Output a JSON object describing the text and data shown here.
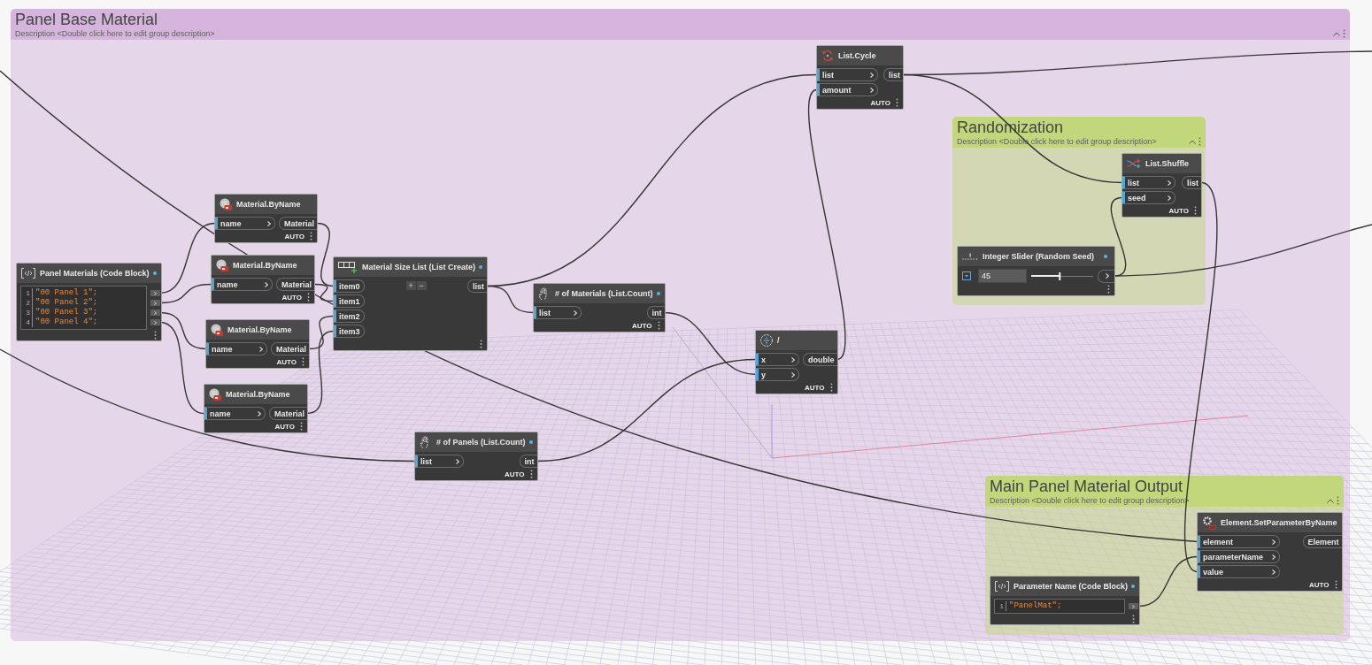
{
  "groups": [
    {
      "title": "Panel Base Material",
      "description": "Description <Double click here to edit group description>",
      "color": "#d5b5dc",
      "nodes": [
        {
          "kind": "cycle",
          "title": "List.Cycle",
          "renamed": false,
          "inputs": [
            "list",
            "amount"
          ],
          "outputs": [
            "list"
          ],
          "lacing": "AUTO"
        },
        {
          "kind": "material",
          "title": "Material.ByName",
          "renamed": false,
          "inputs": [
            "name"
          ],
          "outputs": [
            "Material"
          ],
          "lacing": "AUTO"
        },
        {
          "kind": "codeblock",
          "title": "Panel Materials (Code Block)",
          "renamed": true,
          "lines": [
            {
              "number": "1",
              "code": "\"00 Panel 1\";"
            },
            {
              "number": "2",
              "code": "\"00 Panel 2\";"
            },
            {
              "number": "3",
              "code": "\"00 Panel 3\";"
            },
            {
              "number": "4",
              "code": "\"00 Panel 4\";"
            }
          ]
        },
        {
          "kind": "material",
          "title": "Material.ByName",
          "renamed": false,
          "inputs": [
            "name"
          ],
          "outputs": [
            "Material"
          ],
          "lacing": "AUTO"
        },
        {
          "kind": "material",
          "title": "Material.ByName",
          "renamed": false,
          "inputs": [
            "name"
          ],
          "outputs": [
            "Material"
          ],
          "lacing": "AUTO"
        },
        {
          "kind": "listcreate",
          "title": "Material Size List (List Create)",
          "renamed": true,
          "inputs": [
            "item0",
            "item1",
            "item2",
            "item3"
          ],
          "buttons": [
            "+",
            "−"
          ],
          "outputs": [
            "list"
          ]
        },
        {
          "kind": "count",
          "title": "# of Materials (List.Count)",
          "renamed": true,
          "inputs": [
            "list"
          ],
          "outputs": [
            "int"
          ],
          "lacing": "AUTO"
        },
        {
          "kind": "divide",
          "title": "/",
          "renamed": false,
          "inputs": [
            "x",
            "y"
          ],
          "outputs": [
            "double"
          ],
          "lacing": "AUTO"
        },
        {
          "kind": "material",
          "title": "Material.ByName",
          "renamed": false,
          "inputs": [
            "name"
          ],
          "outputs": [
            "Material"
          ],
          "lacing": "AUTO"
        },
        {
          "kind": "count",
          "title": "# of Panels (List.Count)",
          "renamed": true,
          "inputs": [
            "list"
          ],
          "outputs": [
            "int"
          ],
          "lacing": "AUTO"
        }
      ]
    },
    {
      "title": "Randomization",
      "description": "Description <Double click here to edit group description>",
      "color": "#c2d77b",
      "nodes": [
        {
          "kind": "shuffle",
          "title": "List.Shuffle",
          "renamed": false,
          "inputs": [
            "list",
            "seed"
          ],
          "outputs": [
            "list"
          ],
          "lacing": "AUTO"
        },
        {
          "kind": "slider",
          "title": "Integer Slider (Random Seed)",
          "renamed": true,
          "value": "45",
          "level": 0.46
        }
      ]
    },
    {
      "title": "Main Panel Material Output",
      "description": "Description <Double click here to edit group description>",
      "color": "#c2d77b",
      "nodes": [
        {
          "kind": "codeblock",
          "title": "Parameter Name (Code Block)",
          "renamed": true,
          "lines": [
            {
              "number": "1",
              "code": "\"PanelMat\";"
            }
          ]
        },
        {
          "kind": "setparameter",
          "title": "Element.SetParameterByName",
          "renamed": false,
          "inputs": [
            "element",
            "parameterName",
            "value"
          ],
          "outputs": [
            "Element"
          ],
          "lacing": "AUTO"
        }
      ]
    }
  ]
}
